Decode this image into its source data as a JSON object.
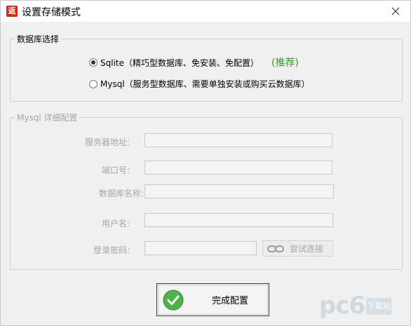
{
  "window": {
    "title": "设置存储模式",
    "app_icon": "返"
  },
  "db_select": {
    "legend": "数据库选择",
    "sqlite_label": "Sqlite（精巧型数据库、免安装、免配置）",
    "sqlite_recommend": "(推荐)",
    "sqlite_selected": true,
    "mysql_label": "Mysql（服务型数据库、需要单独安装或购买云数据库）",
    "mysql_selected": false
  },
  "mysql_detail": {
    "legend": "Mysql 详细配置",
    "server_label": "服务器地址:",
    "server_value": "",
    "port_label": "端口号:",
    "port_value": "",
    "dbname_label": "数据库名称:",
    "dbname_value": "",
    "user_label": "用户名:",
    "user_value": "",
    "password_label": "登录密码:",
    "password_value": "",
    "test_button": "尝试连接"
  },
  "footer": {
    "done_button": "完成配置"
  },
  "watermark": {
    "text": "pc6",
    "badge": "下载站"
  },
  "icons": {
    "app": "app-icon",
    "close": "close-icon",
    "link": "link-icon",
    "check": "check-icon"
  },
  "colors": {
    "recommend": "#2aa12a",
    "app_icon": "#d42a1e",
    "disabled_text": "#a6a6a6"
  }
}
